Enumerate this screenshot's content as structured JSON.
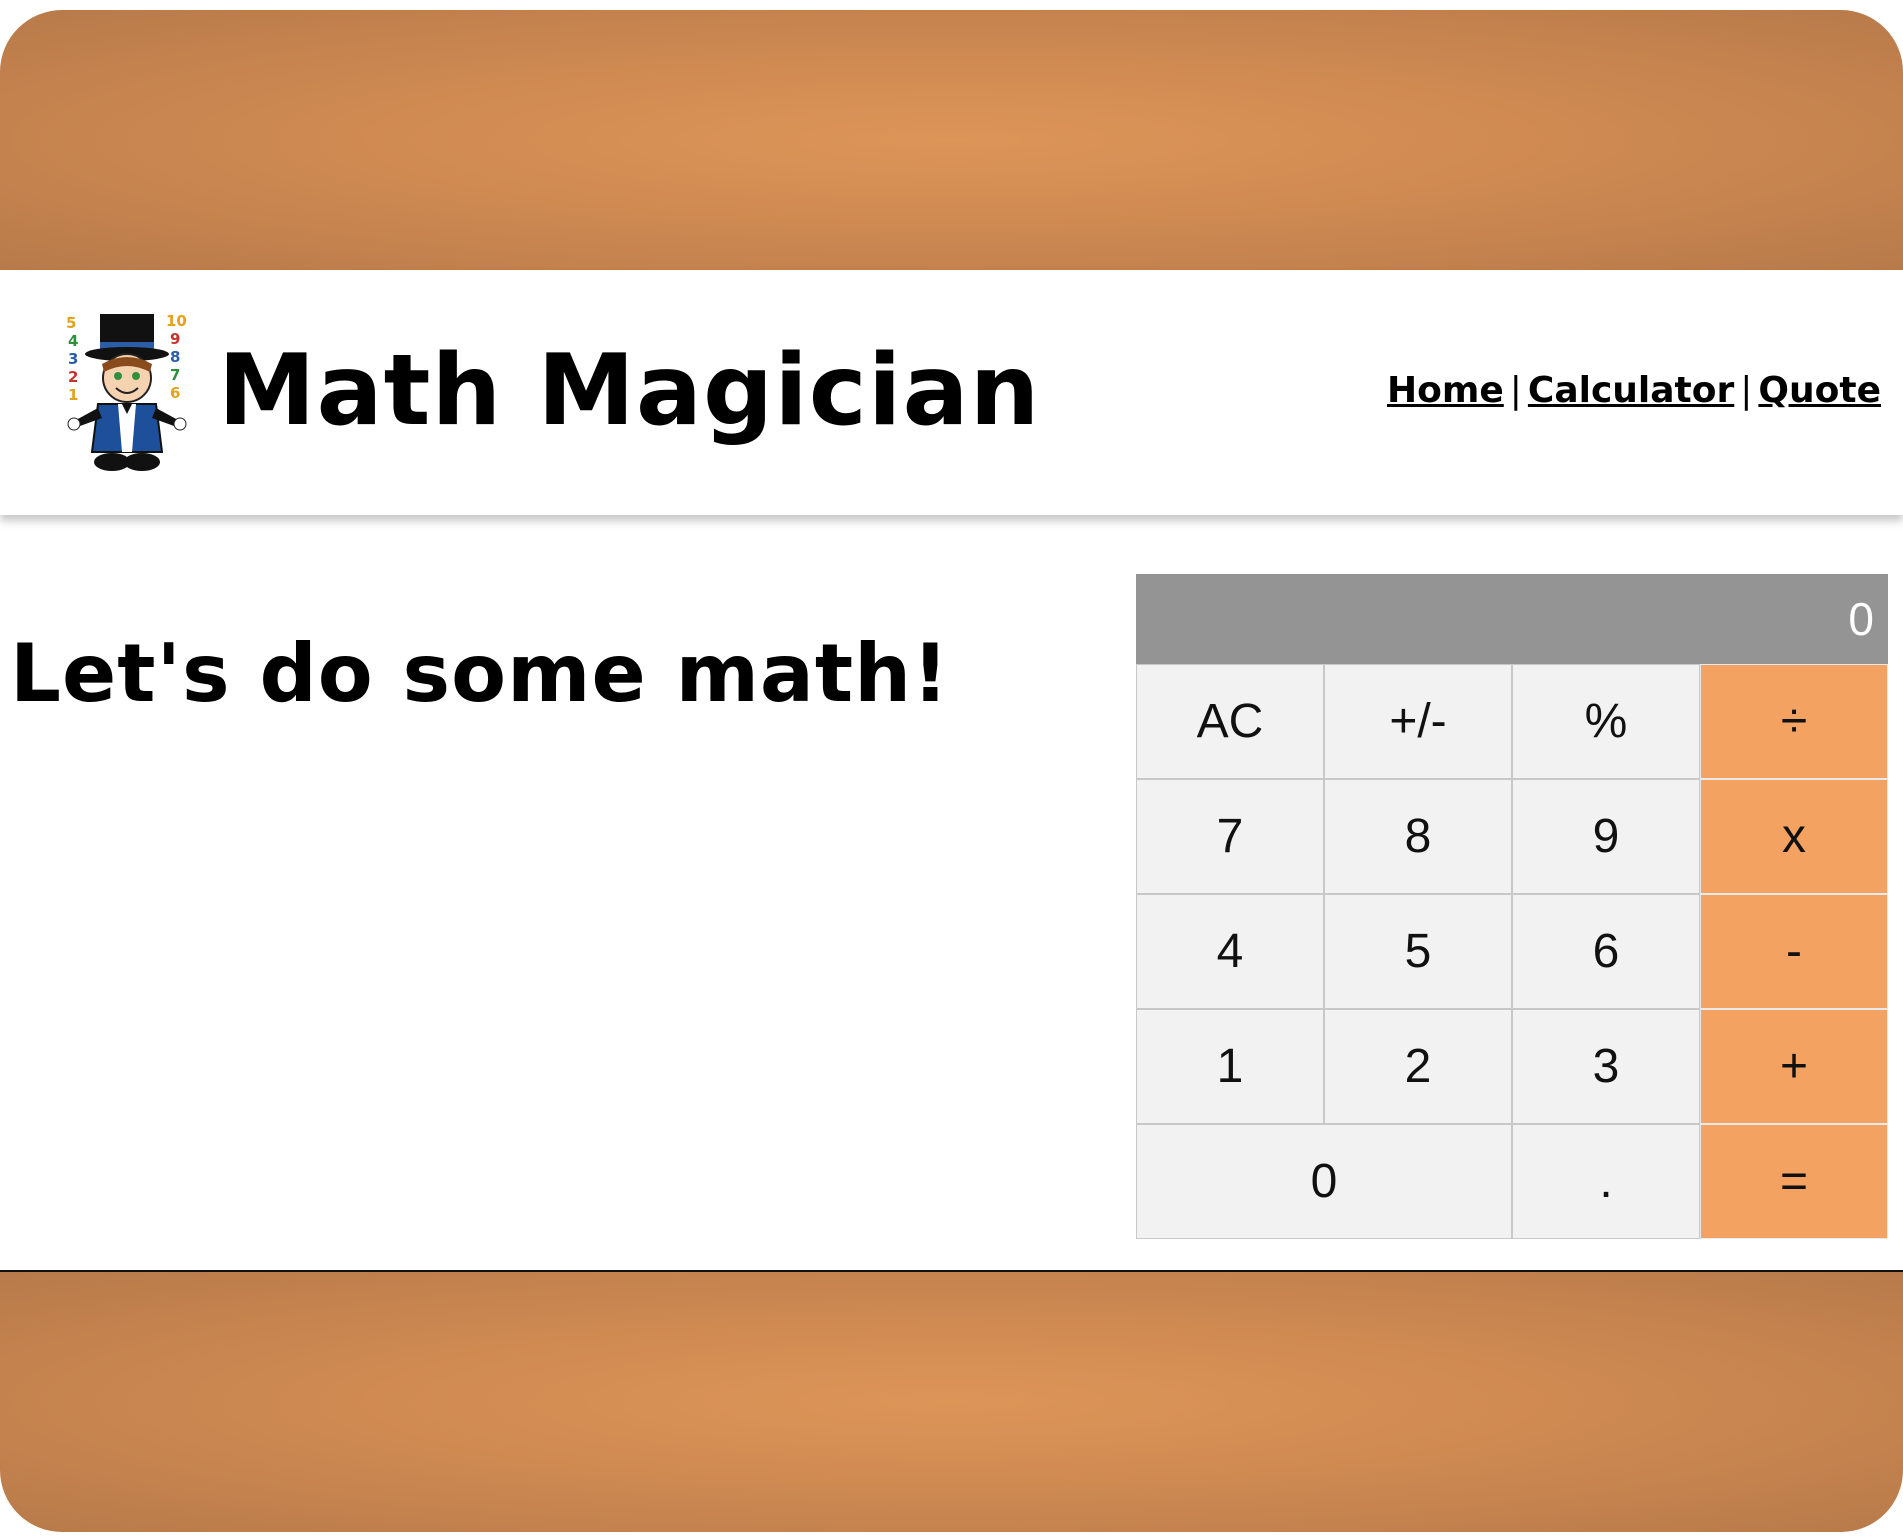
{
  "header": {
    "logo_icon": "magician-juggling-numbers-logo",
    "logo_digits": [
      "5",
      "4",
      "3",
      "2",
      "1",
      "10",
      "9",
      "8",
      "7",
      "6"
    ],
    "title": "Math Magician",
    "nav": {
      "home": "Home",
      "calculator": "Calculator",
      "quote": "Quote",
      "separator": "|"
    }
  },
  "main": {
    "heading": "Let's do some math!"
  },
  "calculator": {
    "display": "0",
    "keys": {
      "ac": "AC",
      "plus_minus": "+/-",
      "percent": "%",
      "divide": "÷",
      "seven": "7",
      "eight": "8",
      "nine": "9",
      "multiply": "x",
      "four": "4",
      "five": "5",
      "six": "6",
      "minus": "-",
      "one": "1",
      "two": "2",
      "three": "3",
      "plus": "+",
      "zero": "0",
      "dot": ".",
      "equals": "="
    }
  },
  "colors": {
    "band": "#d08b52",
    "operator": "#f4a261",
    "display_bg": "#949494",
    "key_bg": "#f2f2f2"
  }
}
